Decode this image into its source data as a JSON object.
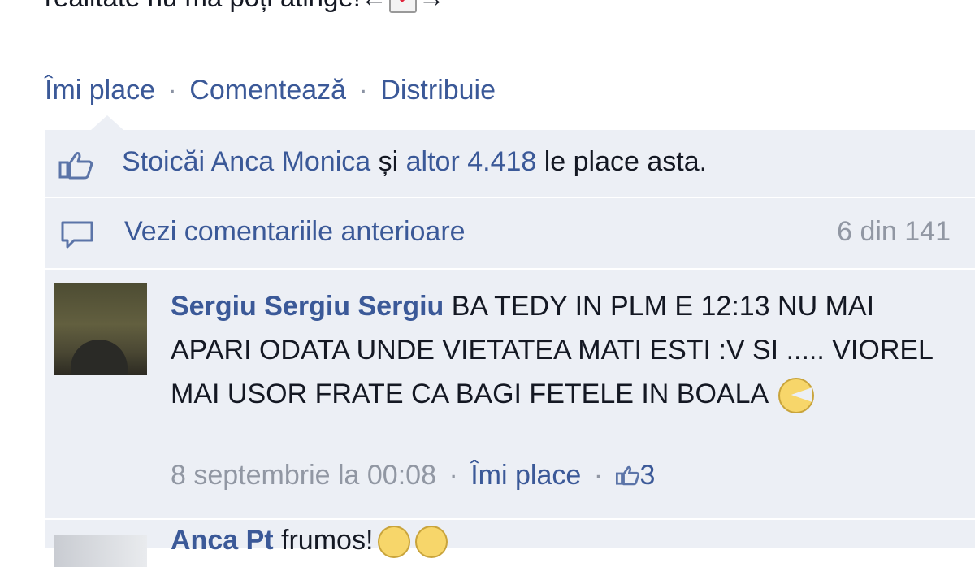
{
  "post": {
    "text_tail": "realitate nu mă poți atinge!",
    "arrow_left": "←",
    "arrow_right": "→"
  },
  "actions": {
    "like": "Îmi place",
    "comment": "Comentează",
    "share": "Distribuie",
    "separator": "·"
  },
  "likes": {
    "name": "Stoicăi Anca Monica",
    "conjunction": " și ",
    "others": "altor 4.418",
    "suffix": " le place asta."
  },
  "previous_comments": {
    "label": "Vezi comentariile anterioare",
    "count": "6 din 141"
  },
  "comment": {
    "author": "Sergiu Sergiu Sergiu",
    "text": " BA TEDY IN PLM E 12:13 NU MAI APARI ODATA UNDE VIETATEA MATI ESTI :V SI ..... VIOREL MAI USOR FRATE CA BAGI FETELE IN BOALA ",
    "timestamp": "8 septembrie la 00:08",
    "like_label": "Îmi place",
    "like_count": "3"
  },
  "next_comment": {
    "author": "Anca Pt",
    "text": " frumos!"
  },
  "colors": {
    "link": "#3b5998",
    "ufi_background": "#eceff5",
    "meta_gray": "#9197a3"
  }
}
